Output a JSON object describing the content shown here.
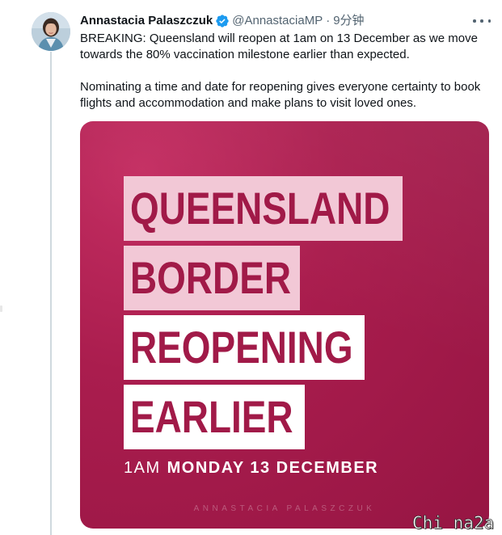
{
  "tweet": {
    "display_name": "Annastacia Palaszczuk",
    "handle": "@AnnastaciaMP",
    "separator": "·",
    "time": "9分钟",
    "verified": true,
    "paragraphs": [
      "BREAKING: Queensland will reopen at 1am on 13 December as we move towards the 80% vaccination milestone earlier than expected.",
      "Nominating a time and date for reopening gives everyone certainty to book flights and accommodation and make plans to visit loved ones."
    ]
  },
  "media": {
    "headline_lines": [
      "QUEENSLAND",
      "BORDER",
      "REOPENING",
      "EARLIER"
    ],
    "subline_light": "1AM",
    "subline_bold": "MONDAY 13 DECEMBER",
    "credit": "ANNASTACIA PALASZCZUK"
  },
  "watermark": "Chi na2a",
  "icons": {
    "verified": "verified-badge-icon",
    "more": "more-options-icon"
  },
  "colors": {
    "verified_blue": "#1d9bf0",
    "media_background": "#a61c4c",
    "headline_text": "#a11a48",
    "highlight_pink": "#f2c8d6",
    "highlight_white": "#ffffff",
    "secondary_text": "#536471"
  }
}
